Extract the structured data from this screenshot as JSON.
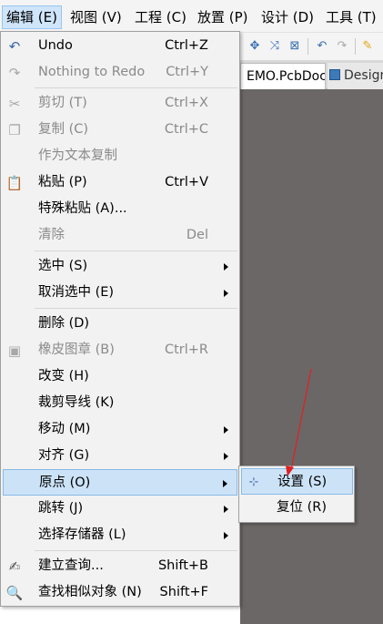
{
  "menubar": {
    "items": [
      {
        "label": "编辑 (E)",
        "active": true
      },
      {
        "label": "视图 (V)"
      },
      {
        "label": "工程 (C)"
      },
      {
        "label": "放置 (P)"
      },
      {
        "label": "设计 (D)"
      },
      {
        "label": "工具 (T)"
      }
    ]
  },
  "tabs": {
    "active": "EMO.PcbDoc *",
    "other": "Design"
  },
  "edit_menu": {
    "items": [
      {
        "label": "Undo",
        "shortcut": "Ctrl+Z",
        "icon": "undo-icon"
      },
      {
        "label": "Nothing to Redo",
        "shortcut": "Ctrl+Y",
        "icon": "redo-icon",
        "disabled": true
      },
      {
        "label": "剪切 (T)",
        "shortcut": "Ctrl+X",
        "icon": "cut-icon",
        "disabled": true
      },
      {
        "label": "复制 (C)",
        "shortcut": "Ctrl+C",
        "icon": "copy-icon",
        "disabled": true
      },
      {
        "label": "作为文本复制",
        "shortcut": "",
        "disabled": true
      },
      {
        "label": "粘贴 (P)",
        "shortcut": "Ctrl+V",
        "icon": "paste-icon"
      },
      {
        "label": "特殊粘贴 (A)...",
        "shortcut": ""
      },
      {
        "label": "清除",
        "shortcut": "Del",
        "disabled": true
      },
      {
        "label": "选中 (S)",
        "submenu": true
      },
      {
        "label": "取消选中 (E)",
        "submenu": true
      },
      {
        "label": "删除 (D)",
        "shortcut": ""
      },
      {
        "label": "橡皮图章 (B)",
        "shortcut": "Ctrl+R",
        "icon": "rubber-stamp-icon",
        "disabled": true
      },
      {
        "label": "改变 (H)",
        "shortcut": ""
      },
      {
        "label": "裁剪导线 (K)",
        "shortcut": ""
      },
      {
        "label": "移动 (M)",
        "submenu": true
      },
      {
        "label": "对齐 (G)",
        "submenu": true
      },
      {
        "label": "原点 (O)",
        "submenu": true,
        "highlight": true
      },
      {
        "label": "跳转 (J)",
        "submenu": true
      },
      {
        "label": "选择存储器 (L)",
        "submenu": true
      },
      {
        "label": "建立查询...",
        "shortcut": "Shift+B",
        "icon": "query-icon"
      },
      {
        "label": "查找相似对象 (N)",
        "shortcut": "Shift+F",
        "icon": "find-similar-icon"
      }
    ]
  },
  "origin_submenu": {
    "items": [
      {
        "label": "设置 (S)",
        "icon": "set-origin-icon",
        "highlight": true
      },
      {
        "label": "复位 (R)"
      }
    ]
  },
  "colors": {
    "highlight": "#cce3f7",
    "canvas": "#6b6766",
    "annotation": "#e02020"
  }
}
